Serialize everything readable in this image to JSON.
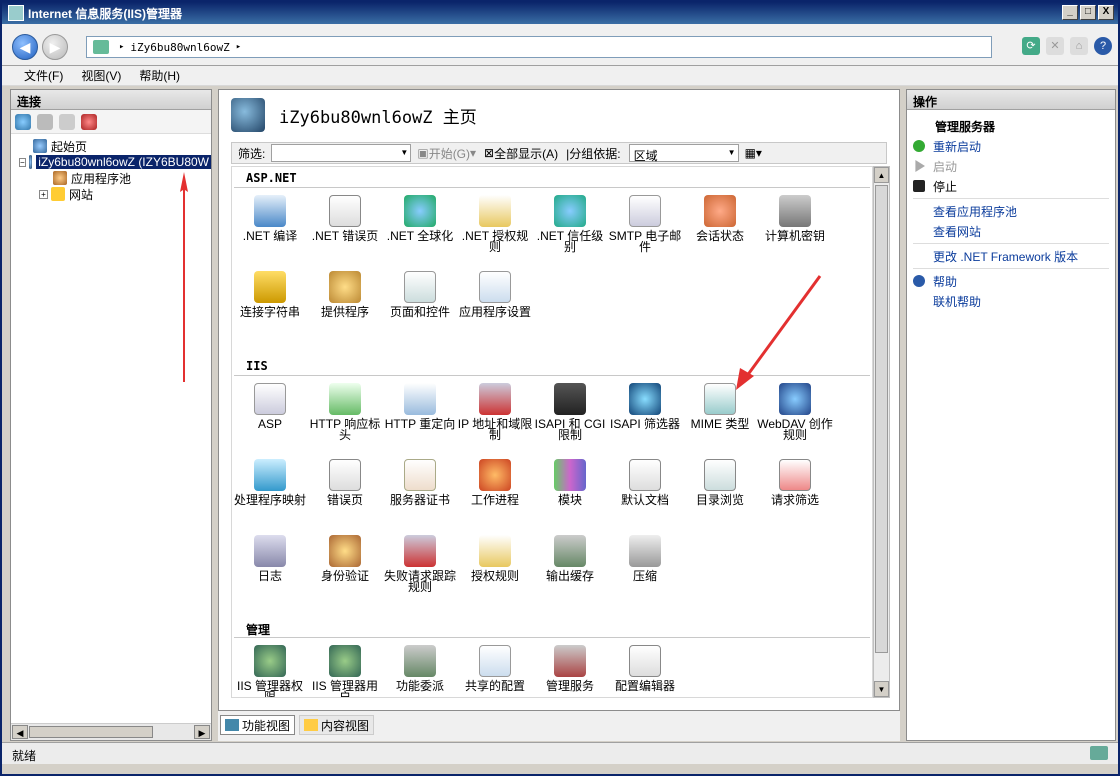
{
  "window": {
    "title": "Internet 信息服务(IIS)管理器"
  },
  "titlebar_buttons": [
    "_",
    "□",
    "X"
  ],
  "address": {
    "text": "iZy6bu80wnl6owZ",
    "separator": "▸"
  },
  "menu": [
    "文件(F)",
    "视图(V)",
    "帮助(H)"
  ],
  "connections": {
    "header": "连接",
    "tree": [
      {
        "label": "起始页",
        "level": 1,
        "expand": ""
      },
      {
        "label": "iZy6bu80wnl6owZ (IZY6BU80W",
        "level": 0,
        "expand": "−",
        "selected": true
      },
      {
        "label": "应用程序池",
        "level": 2,
        "expand": ""
      },
      {
        "label": "网站",
        "level": 1,
        "expand": "+"
      }
    ]
  },
  "center": {
    "title": "iZy6bu80wnl6owZ 主页",
    "filter_label": "筛选:",
    "start_label": "开始(G)",
    "showall_label": "全部显示(A)",
    "groupby_label": "|分组依据:",
    "groupby_value": "区域",
    "sections": [
      {
        "name": "ASP.NET",
        "items": [
          ".NET 编译",
          ".NET 错误页",
          ".NET 全球化",
          ".NET 授权规则",
          ".NET 信任级别",
          "SMTP 电子邮件",
          "会话状态",
          "计算机密钥",
          "连接字符串",
          "提供程序",
          "页面和控件",
          "应用程序设置"
        ]
      },
      {
        "name": "IIS",
        "items": [
          "ASP",
          "HTTP 响应标头",
          "HTTP 重定向",
          "IP 地址和域限制",
          "ISAPI 和 CGI 限制",
          "ISAPI 筛选器",
          "MIME 类型",
          "WebDAV 创作规则",
          "处理程序映射",
          "错误页",
          "服务器证书",
          "工作进程",
          "模块",
          "默认文档",
          "目录浏览",
          "请求筛选",
          "日志",
          "身份验证",
          "失败请求跟踪规则",
          "授权规则",
          "输出缓存",
          "压缩"
        ]
      },
      {
        "name": "管理",
        "items": [
          "IIS 管理器权限",
          "IIS 管理器用户",
          "功能委派",
          "共享的配置",
          "管理服务",
          "配置编辑器"
        ]
      }
    ],
    "tabs": [
      "功能视图",
      "内容视图"
    ]
  },
  "actions": {
    "header": "操作",
    "group_title": "管理服务器",
    "items": [
      {
        "label": "重新启动",
        "state": "link",
        "icon": "restart-icon"
      },
      {
        "label": "启动",
        "state": "disabled",
        "icon": "start-icon"
      },
      {
        "label": "停止",
        "state": "link-black",
        "icon": "stop-icon"
      },
      {
        "label": "查看应用程序池",
        "state": "link"
      },
      {
        "label": "查看网站",
        "state": "link"
      },
      {
        "label": "更改 .NET Framework 版本",
        "state": "link"
      },
      {
        "label": "帮助",
        "state": "link",
        "icon": "help-icon"
      },
      {
        "label": "联机帮助",
        "state": "link"
      }
    ]
  },
  "status": {
    "text": "就绪"
  },
  "colors": {
    "titlebar": "#0a246a",
    "link": "#0b3c9c",
    "arrow": "#e33030",
    "selection": "#0a246a"
  }
}
